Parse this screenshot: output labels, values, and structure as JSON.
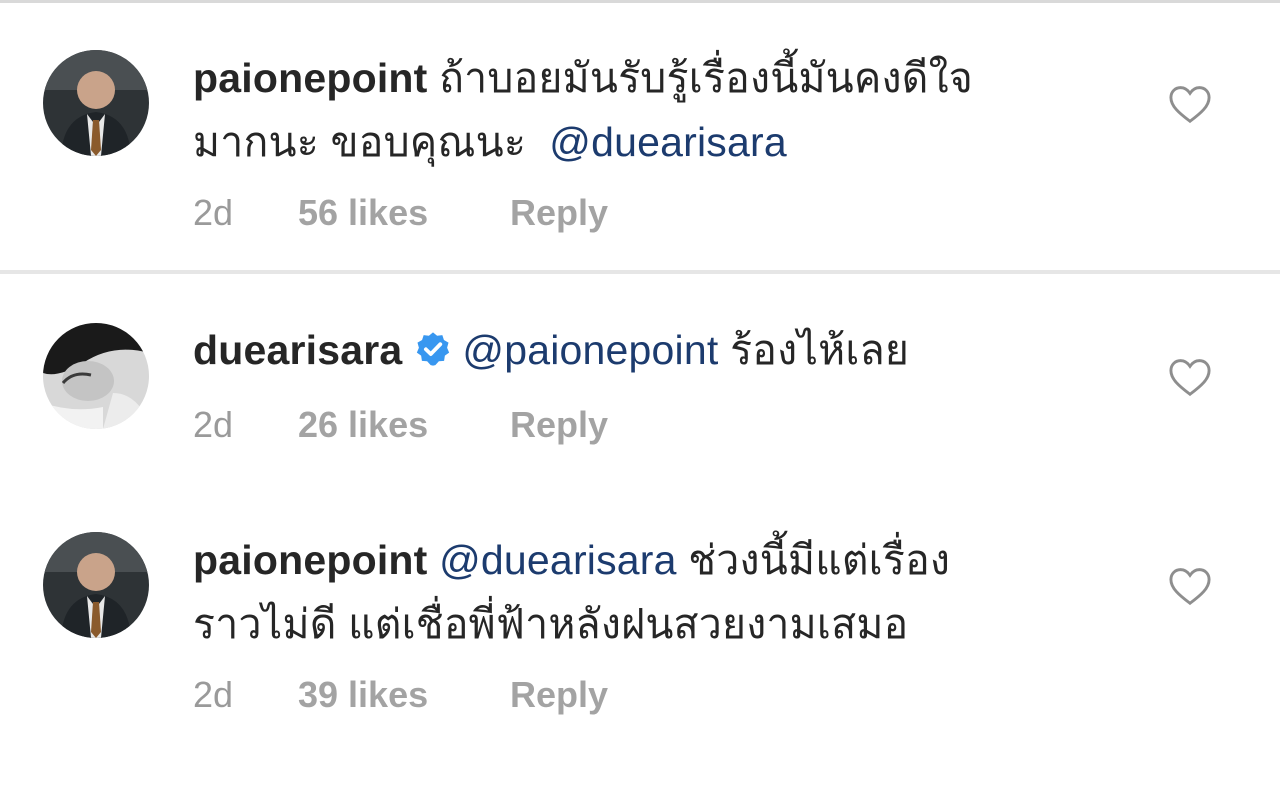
{
  "comments": [
    {
      "username": "paionepoint",
      "verified": false,
      "text_before_mention": "ถ้าบอยมันรับรู้เรื่องนี้มันคงดีใจมากนะ ขอบคุณนะ",
      "line1": "ถ้าบอยมันรับรู้เรื่องนี้มันคงดีใจ",
      "line2": "มากนะ  ขอบคุณนะ",
      "mention": "@duearisara",
      "time": "2d",
      "likes": "56 likes",
      "reply_label": "Reply"
    },
    {
      "username": "duearisara",
      "verified": true,
      "mention": "@paionepoint",
      "text_after_mention": "ร้องไห้เลย",
      "time": "2d",
      "likes": "26 likes",
      "reply_label": "Reply"
    },
    {
      "username": "paionepoint",
      "verified": false,
      "mention": "@duearisara",
      "line1_after_mention": "ช่วงนี้มีแต่เรื่อง",
      "line2": "ราวไม่ดี  แต่เชื่อพี่ฟ้าหลังฝนสวยงามเสมอ",
      "time": "2d",
      "likes": "39 likes",
      "reply_label": "Reply"
    }
  ],
  "colors": {
    "text": "#262626",
    "mention": "#1c3b6e",
    "meta": "#9a9a9a",
    "verified": "#3897f0"
  },
  "icons": [
    "heart-outline-icon",
    "verified-badge-icon"
  ]
}
